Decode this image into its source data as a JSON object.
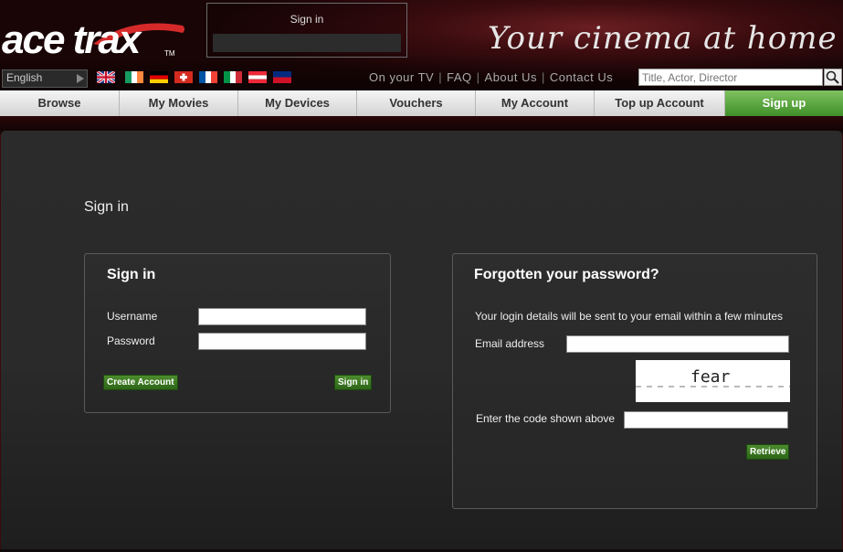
{
  "header": {
    "logo_text": "ace trax",
    "logo_tm": "TM",
    "tagline": "Your cinema at home",
    "signin_box_title": "Sign in"
  },
  "language": {
    "selected": "English"
  },
  "flags": [
    "uk-flag",
    "ireland-flag",
    "germany-flag",
    "switzerland-flag",
    "france-flag",
    "italy-flag",
    "austria-flag",
    "liechtenstein-flag"
  ],
  "toplinks": [
    "On your TV",
    "FAQ",
    "About Us",
    "Contact Us"
  ],
  "search": {
    "placeholder": "Title, Actor, Director"
  },
  "nav": [
    "Browse",
    "My Movies",
    "My Devices",
    "Vouchers",
    "My Account",
    "Top up Account",
    "Sign up"
  ],
  "page": {
    "title": "Sign in"
  },
  "signin_panel": {
    "heading": "Sign in",
    "username_label": "Username",
    "password_label": "Password",
    "create_account": "Create Account",
    "signin_button": "Sign in"
  },
  "forgot_panel": {
    "heading": "Forgotten your password?",
    "info": "Your login details will be sent to your email within a few minutes",
    "email_label": "Email address",
    "captcha_text": "fear",
    "code_label": "Enter the code shown above",
    "retrieve_button": "Retrieve"
  },
  "colors": {
    "accent_green": "#3f8f2a",
    "header_red": "#6a1e22"
  }
}
